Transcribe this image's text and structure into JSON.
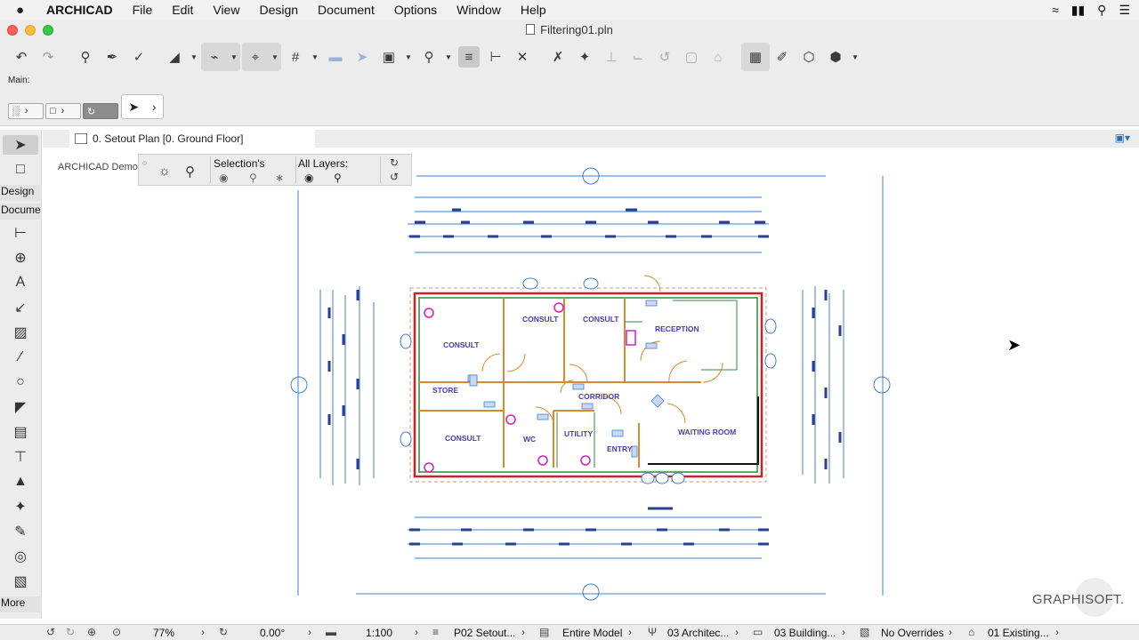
{
  "menubar": {
    "apple": "",
    "app": "ARCHICAD",
    "items": [
      "File",
      "Edit",
      "View",
      "Design",
      "Document",
      "Options",
      "Window",
      "Help"
    ]
  },
  "window": {
    "title": "Filtering01.pln"
  },
  "infobox": {
    "main_label": "Main:"
  },
  "toolbox": {
    "design": "Design",
    "document": "Docume",
    "more": "More"
  },
  "tab": {
    "label": "0. Setout Plan [0. Ground Floor]"
  },
  "canvas": {
    "project_label": "ARCHICAD Demo",
    "quick_options": {
      "selection": "Selection's",
      "all_layers": "All Layers:"
    },
    "rooms": [
      "CONSULT",
      "CONSULT",
      "CONSULT",
      "RECEPTION",
      "STORE",
      "CORRIDOR",
      "CONSULT",
      "WC",
      "UTILITY",
      "ENTRY",
      "WAITING ROOM"
    ],
    "logo": "GRAPHISOFT."
  },
  "status": {
    "zoom": "77%",
    "angle": "0.00°",
    "scale": "1:100",
    "layer_combo": "P02 Setout...",
    "model_view": "Entire Model",
    "pen_set": "03 Architec...",
    "mvo": "03 Building...",
    "overrides": "No Overrides",
    "renovation": "01 Existing..."
  },
  "colors": {
    "wall_red": "#cc2222",
    "wall_green": "#2c8a3a",
    "wall_orange": "#d98a2a",
    "dim_blue": "#3f7fd1",
    "label_purple": "#4a3cb0"
  }
}
